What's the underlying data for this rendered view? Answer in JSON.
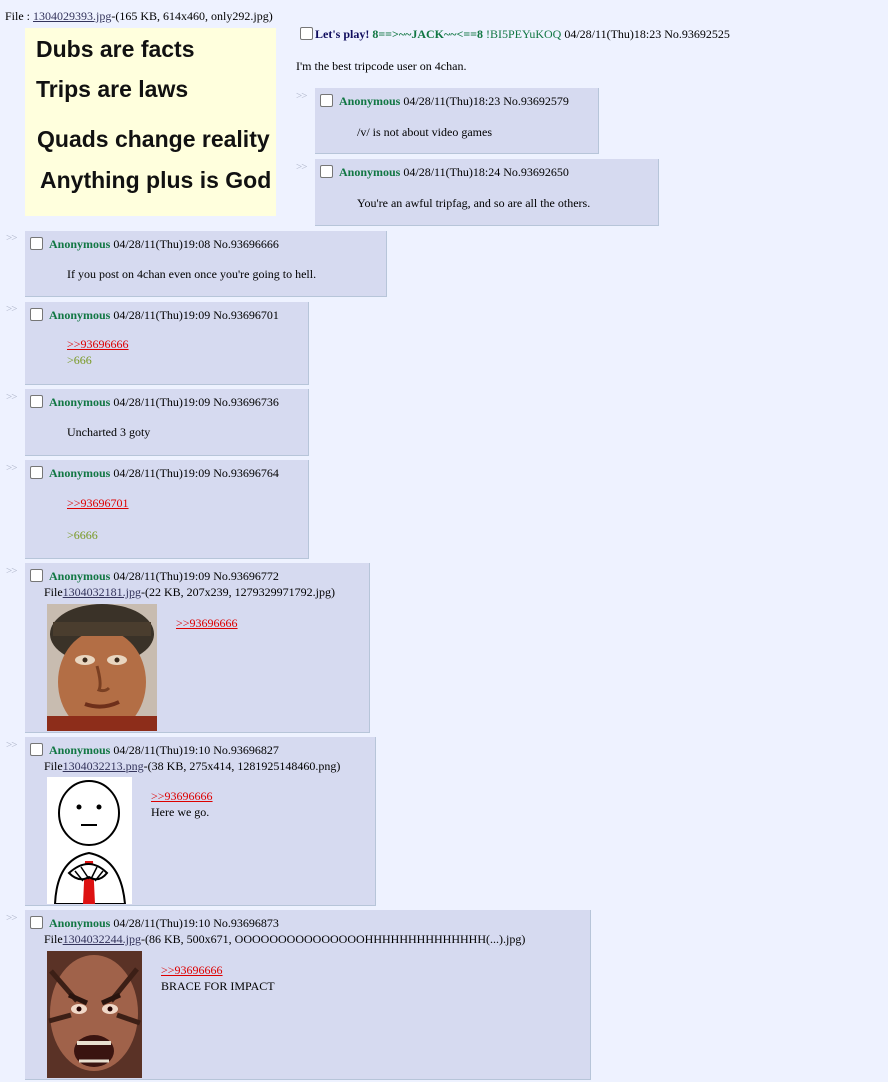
{
  "op": {
    "file_prefix": "File : ",
    "filename": "1304029393.jpg",
    "file_meta": "-(165 KB, 614x460, only292.jpg)",
    "image_lines": [
      "Dubs are facts",
      "Trips are laws",
      "Quads change reality",
      "Anything plus is God"
    ],
    "subject": "Let's play!",
    "tripname": "8==>~~JACK~~<==8",
    "tripcode": "!BI5PEYuKOQ",
    "datetime": "04/28/11(Thu)18:23",
    "number": "No.93692525",
    "message": "I'm the best tripcode user on 4chan."
  },
  "arrow_glyph": ">>",
  "posts": [
    {
      "name": "Anonymous",
      "datetime": "04/28/11(Thu)18:23",
      "number": "No.93692579",
      "lines": [
        "/v/ is not about video games"
      ]
    },
    {
      "name": "Anonymous",
      "datetime": "04/28/11(Thu)18:24",
      "number": "No.93692650",
      "lines": [
        "You're an awful tripfag, and so are all the others."
      ]
    },
    {
      "name": "Anonymous",
      "datetime": "04/28/11(Thu)19:08",
      "number": "No.93696666",
      "lines": [
        "If you post on 4chan even once you're going to hell."
      ]
    },
    {
      "name": "Anonymous",
      "datetime": "04/28/11(Thu)19:09",
      "number": "No.93696701",
      "quote": ">>93696666",
      "greentext": ">666"
    },
    {
      "name": "Anonymous",
      "datetime": "04/28/11(Thu)19:09",
      "number": "No.93696736",
      "lines": [
        "Uncharted 3 goty"
      ]
    },
    {
      "name": "Anonymous",
      "datetime": "04/28/11(Thu)19:09",
      "number": "No.93696764",
      "quote": ">>93696701",
      "greentext": ">6666"
    },
    {
      "name": "Anonymous",
      "datetime": "04/28/11(Thu)19:09",
      "number": "No.93696772",
      "file_prefix": "File",
      "filename": "1304032181.jpg",
      "file_meta": "-(22 KB, 207x239, 1279329971792.jpg)",
      "quote": ">>93696666"
    },
    {
      "name": "Anonymous",
      "datetime": "04/28/11(Thu)19:10",
      "number": "No.93696827",
      "file_prefix": "File",
      "filename": "1304032213.png",
      "file_meta": "-(38 KB, 275x414, 1281925148460.png)",
      "quote": ">>93696666",
      "lines": [
        "Here we go."
      ]
    },
    {
      "name": "Anonymous",
      "datetime": "04/28/11(Thu)19:10",
      "number": "No.93696873",
      "file_prefix": "File",
      "filename": "1304032244.jpg",
      "file_meta": "-(86 KB, 500x671, OOOOOOOOOOOOOOOHHHHHHHHHHHHHH(...).jpg)",
      "quote": ">>93696666",
      "lines": [
        "BRACE FOR IMPACT"
      ]
    }
  ],
  "colors": {
    "page_bg": "#eef2ff",
    "reply_bg": "#d6daf0",
    "name_green": "#117743",
    "subject_blue": "#0f0c5d",
    "quote_red": "#dd0000",
    "greentext": "#789922",
    "op_image_bg": "#ffffdd"
  }
}
